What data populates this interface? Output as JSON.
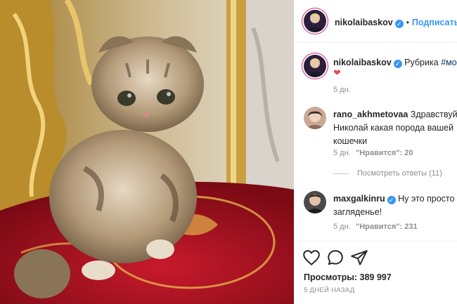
{
  "post": {
    "author": "nikolaibaskov",
    "follow_label": "Подписаться",
    "dot": "•"
  },
  "caption": {
    "author": "nikolaibaskov",
    "text": "Рубрика",
    "hashtag": "#мояш",
    "emoji": "❤",
    "time": "5 дн."
  },
  "comments": [
    {
      "author": "rano_akhmetovaa",
      "text_line1": "Здравствуйте",
      "text_line2": "Николай какая порода вашей",
      "text_line3": "кошечки",
      "time": "5 дн.",
      "likes": "\"Нравится\": 20",
      "replies": "Посмотреть ответы (11)"
    },
    {
      "author": "maxgalkinru",
      "text_line1": "Ну это просто",
      "text_line2": "загляденье!",
      "time": "5 дн.",
      "likes": "\"Нравится\": 231"
    }
  ],
  "footer": {
    "views_label": "Просмотры: 389 997",
    "date": "5 ДНЕЙ НАЗАД"
  },
  "icons": {
    "like": "heart-icon",
    "comment": "comment-icon",
    "share": "send-icon",
    "verified": "verified-icon"
  },
  "colors": {
    "link": "#3897f0",
    "hashtag": "#003569",
    "heart": "#ed4956",
    "muted": "#8e8e8e"
  }
}
